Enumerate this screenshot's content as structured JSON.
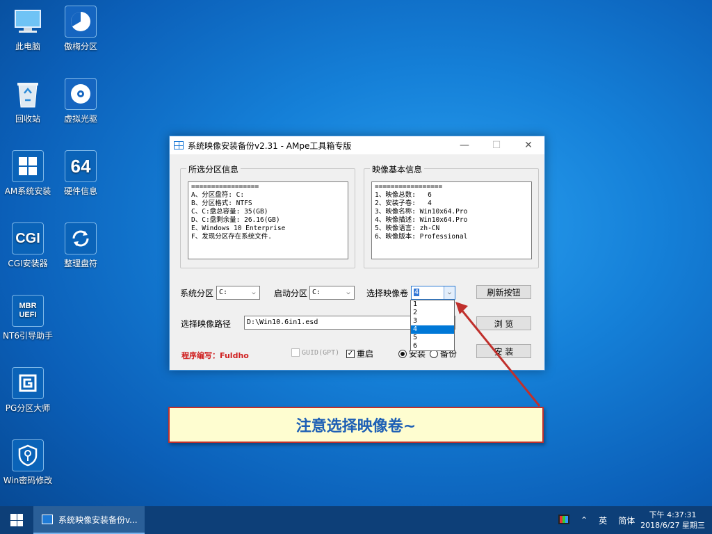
{
  "desktop": {
    "icons": [
      {
        "label": "此电脑",
        "glyph": "monitor-icon"
      },
      {
        "label": "傲梅分区",
        "glyph": "aomei-icon"
      },
      {
        "label": "回收站",
        "glyph": "recycle-bin-icon"
      },
      {
        "label": "虚拟光驱",
        "glyph": "disc-icon"
      },
      {
        "label": "AM系统安装",
        "glyph": "windows-icon"
      },
      {
        "label": "硬件信息",
        "glyph": "64-icon",
        "text": "64"
      },
      {
        "label": "CGI安装器",
        "glyph": "cgi-icon",
        "text": "CGI"
      },
      {
        "label": "整理盘符",
        "glyph": "refresh-icon"
      },
      {
        "label": "NT6引导助手",
        "glyph": "mbr-uefi-icon",
        "text": "MBR",
        "text2": "UEFI"
      },
      {
        "label": "PG分区大师",
        "glyph": "pg-icon"
      },
      {
        "label": "Win密码修改",
        "glyph": "shield-key-icon"
      }
    ]
  },
  "window": {
    "title": "系统映像安装备份v2.31 - AMpe工具箱专版",
    "minimize": "—",
    "maximize": "☐",
    "close": "✕",
    "left_group": {
      "legend": "所选分区信息",
      "lines": "=================\nA、分区盘符: C:\nB、分区格式: NTFS\nC、C:盘总容量: 35(GB)\nD、C:盘剩余量: 26.16(GB)\nE、Windows 10 Enterprise\nF、发现分区存在系统文件."
    },
    "right_group": {
      "legend": "映像基本信息",
      "lines": "=================\n1、映像总数:   6\n2、安装子卷:   4\n3、映像名称: Win10x64.Pro\n4、映像描述: Win10x64.Pro\n5、映像语言: zh-CN\n6、映像版本: Professional"
    },
    "system_partition": {
      "label": "系统分区",
      "value": "C:"
    },
    "boot_partition": {
      "label": "启动分区",
      "value": "C:"
    },
    "image_volume": {
      "label": "选择映像卷",
      "value": "4",
      "options": [
        "1",
        "2",
        "3",
        "4",
        "5",
        "6"
      ],
      "highlighted": "4"
    },
    "refresh_button": "刷新按钮",
    "image_path": {
      "label": "选择映像路径",
      "value": "D:\\Win10.6in1.esd"
    },
    "browse_button": "浏  览",
    "install_button": "安  装",
    "author": "程序编写：Fuldho",
    "guid_checkbox": {
      "label": "GUID(GPT)",
      "checked": false,
      "disabled": true
    },
    "reboot_checkbox": {
      "label": "重启",
      "checked": true
    },
    "radio_install": {
      "label": "安装",
      "checked": true
    },
    "radio_backup": {
      "label": "备份",
      "checked": false
    }
  },
  "callout": {
    "text": "注意选择映像卷~",
    "border_color": "#c0302c",
    "text_color": "#1d5fb5"
  },
  "taskbar": {
    "task_label": "系统映像安装备份v...",
    "tray_ime": "英",
    "tray_lang": "简体",
    "time": "下午 4:37:31",
    "date": "2018/6/27 星期三"
  }
}
